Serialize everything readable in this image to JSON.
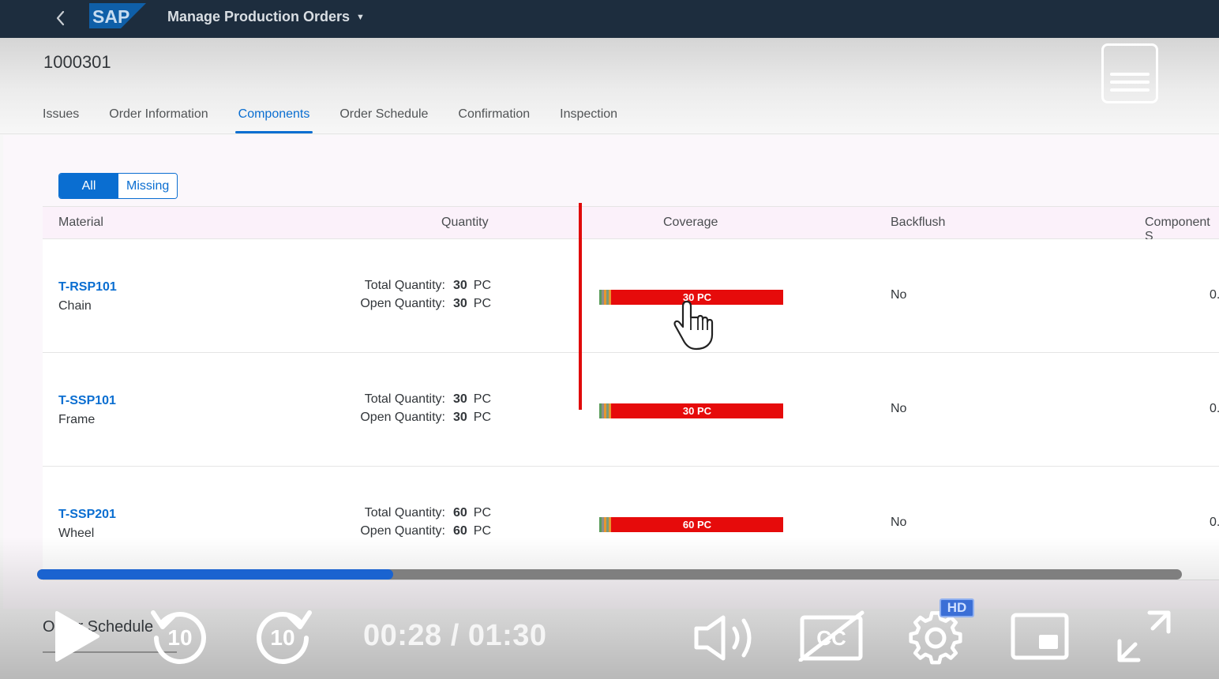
{
  "shell": {
    "app_title": "Manage Production Orders",
    "logo": "SAP"
  },
  "header": {
    "order_id": "1000301"
  },
  "tabs": [
    {
      "label": "Issues"
    },
    {
      "label": "Order Information"
    },
    {
      "label": "Components",
      "active": true
    },
    {
      "label": "Order Schedule"
    },
    {
      "label": "Confirmation"
    },
    {
      "label": "Inspection"
    }
  ],
  "filter": {
    "all": "All",
    "missing": "Missing",
    "selected": "All"
  },
  "table": {
    "columns": [
      "Material",
      "Quantity",
      "Coverage",
      "Backflush",
      "Component S"
    ],
    "quantity_labels": {
      "total": "Total Quantity:",
      "open": "Open Quantity:"
    },
    "rows": [
      {
        "material": "T-RSP101",
        "description": "Chain",
        "total_qty": "30",
        "total_unit": "PC",
        "open_qty": "30",
        "open_unit": "PC",
        "coverage": "30 PC",
        "backflush": "No",
        "component": "0."
      },
      {
        "material": "T-SSP101",
        "description": "Frame",
        "total_qty": "30",
        "total_unit": "PC",
        "open_qty": "30",
        "open_unit": "PC",
        "coverage": "30 PC",
        "backflush": "No",
        "component": "0."
      },
      {
        "material": "T-SSP201",
        "description": "Wheel",
        "total_qty": "60",
        "total_unit": "PC",
        "open_qty": "60",
        "open_unit": "PC",
        "coverage": "60 PC",
        "backflush": "No",
        "component": "0."
      }
    ]
  },
  "colors": {
    "shellbar": "#1d2d3e",
    "accent": "#0a6ed1",
    "coverage_red": "#e60b0b",
    "progress": "#1a63d0"
  },
  "video": {
    "time": "00:28 / 01:30",
    "progress_fraction": 0.311,
    "rewind_label": "10",
    "forward_label": "10",
    "hd_badge": "HD",
    "underlying_tab": "Order Schedule",
    "icons": [
      "play-icon",
      "rewind-10-icon",
      "forward-10-icon",
      "volume-icon",
      "captions-off-icon",
      "settings-icon",
      "miniplayer-icon",
      "fullscreen-icon"
    ]
  }
}
